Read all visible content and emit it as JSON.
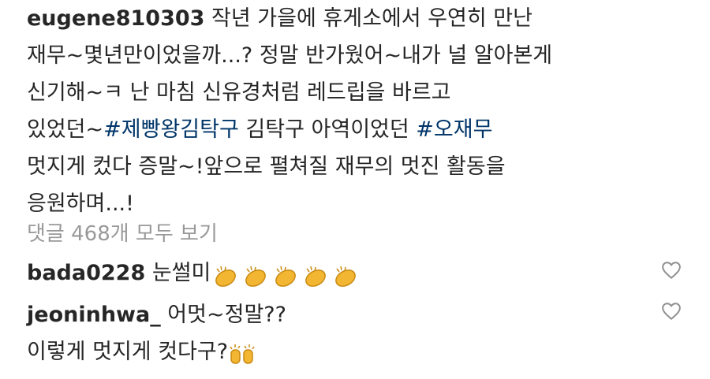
{
  "post": {
    "username": "eugene810303",
    "lines": [
      {
        "pre": "작년 가을에 휴게소에서 우연히 만난"
      },
      {
        "pre": "재무~몇년만이었을까...? 정말 반가웠어~내가 널 알아본게"
      },
      {
        "pre": "신기해~ㅋ 난 마침 신유경처럼 레드립을 바르고"
      },
      {
        "pre": "있었던~",
        "hashtag1": "#제빵왕김탁구",
        "mid": " 김탁구 아역이었던 ",
        "hashtag2": "#오재무"
      },
      {
        "pre": "멋지게 컸다 증말~!앞으로 펼쳐질 재무의 멋진 활동을"
      },
      {
        "pre": "응원하며...!"
      }
    ]
  },
  "view_all_comments": "댓글 468개 모두 보기",
  "comments": [
    {
      "username": "bada0228",
      "text": "눈썰미",
      "emoji": "clapping-hands x5"
    },
    {
      "username": "jeoninhwa_",
      "text": "어멋~정말??",
      "line2": "이렇게 멋지게 컷다구?",
      "emoji": "raising-hands"
    }
  ],
  "colors": {
    "text": "#262626",
    "hashtag": "#003569",
    "muted": "#999999",
    "heart": "#8e8e8e",
    "emoji": "#f2b632"
  }
}
